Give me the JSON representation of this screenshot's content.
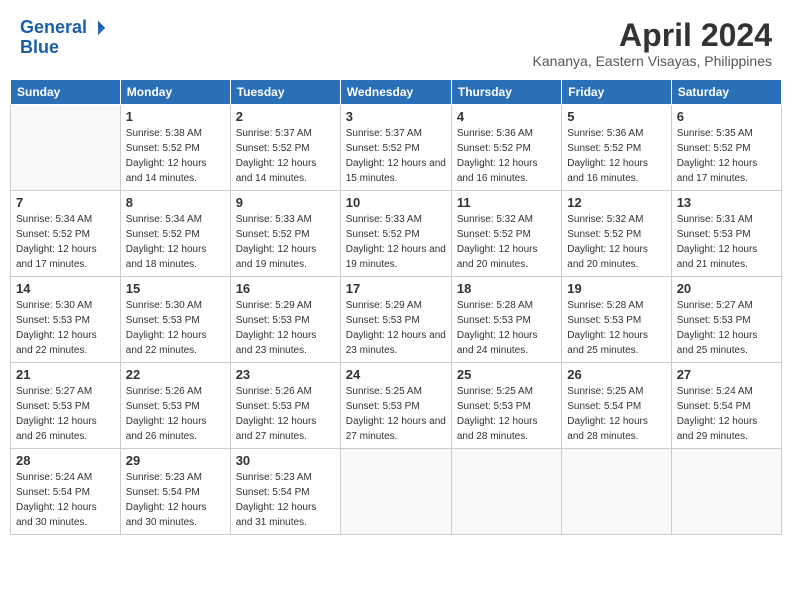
{
  "header": {
    "logo_line1": "General",
    "logo_line2": "Blue",
    "month": "April 2024",
    "location": "Kananya, Eastern Visayas, Philippines"
  },
  "weekdays": [
    "Sunday",
    "Monday",
    "Tuesday",
    "Wednesday",
    "Thursday",
    "Friday",
    "Saturday"
  ],
  "weeks": [
    [
      {
        "day": "",
        "sunrise": "",
        "sunset": "",
        "daylight": ""
      },
      {
        "day": "1",
        "sunrise": "Sunrise: 5:38 AM",
        "sunset": "Sunset: 5:52 PM",
        "daylight": "Daylight: 12 hours and 14 minutes."
      },
      {
        "day": "2",
        "sunrise": "Sunrise: 5:37 AM",
        "sunset": "Sunset: 5:52 PM",
        "daylight": "Daylight: 12 hours and 14 minutes."
      },
      {
        "day": "3",
        "sunrise": "Sunrise: 5:37 AM",
        "sunset": "Sunset: 5:52 PM",
        "daylight": "Daylight: 12 hours and 15 minutes."
      },
      {
        "day": "4",
        "sunrise": "Sunrise: 5:36 AM",
        "sunset": "Sunset: 5:52 PM",
        "daylight": "Daylight: 12 hours and 16 minutes."
      },
      {
        "day": "5",
        "sunrise": "Sunrise: 5:36 AM",
        "sunset": "Sunset: 5:52 PM",
        "daylight": "Daylight: 12 hours and 16 minutes."
      },
      {
        "day": "6",
        "sunrise": "Sunrise: 5:35 AM",
        "sunset": "Sunset: 5:52 PM",
        "daylight": "Daylight: 12 hours and 17 minutes."
      }
    ],
    [
      {
        "day": "7",
        "sunrise": "Sunrise: 5:34 AM",
        "sunset": "Sunset: 5:52 PM",
        "daylight": "Daylight: 12 hours and 17 minutes."
      },
      {
        "day": "8",
        "sunrise": "Sunrise: 5:34 AM",
        "sunset": "Sunset: 5:52 PM",
        "daylight": "Daylight: 12 hours and 18 minutes."
      },
      {
        "day": "9",
        "sunrise": "Sunrise: 5:33 AM",
        "sunset": "Sunset: 5:52 PM",
        "daylight": "Daylight: 12 hours and 19 minutes."
      },
      {
        "day": "10",
        "sunrise": "Sunrise: 5:33 AM",
        "sunset": "Sunset: 5:52 PM",
        "daylight": "Daylight: 12 hours and 19 minutes."
      },
      {
        "day": "11",
        "sunrise": "Sunrise: 5:32 AM",
        "sunset": "Sunset: 5:52 PM",
        "daylight": "Daylight: 12 hours and 20 minutes."
      },
      {
        "day": "12",
        "sunrise": "Sunrise: 5:32 AM",
        "sunset": "Sunset: 5:52 PM",
        "daylight": "Daylight: 12 hours and 20 minutes."
      },
      {
        "day": "13",
        "sunrise": "Sunrise: 5:31 AM",
        "sunset": "Sunset: 5:53 PM",
        "daylight": "Daylight: 12 hours and 21 minutes."
      }
    ],
    [
      {
        "day": "14",
        "sunrise": "Sunrise: 5:30 AM",
        "sunset": "Sunset: 5:53 PM",
        "daylight": "Daylight: 12 hours and 22 minutes."
      },
      {
        "day": "15",
        "sunrise": "Sunrise: 5:30 AM",
        "sunset": "Sunset: 5:53 PM",
        "daylight": "Daylight: 12 hours and 22 minutes."
      },
      {
        "day": "16",
        "sunrise": "Sunrise: 5:29 AM",
        "sunset": "Sunset: 5:53 PM",
        "daylight": "Daylight: 12 hours and 23 minutes."
      },
      {
        "day": "17",
        "sunrise": "Sunrise: 5:29 AM",
        "sunset": "Sunset: 5:53 PM",
        "daylight": "Daylight: 12 hours and 23 minutes."
      },
      {
        "day": "18",
        "sunrise": "Sunrise: 5:28 AM",
        "sunset": "Sunset: 5:53 PM",
        "daylight": "Daylight: 12 hours and 24 minutes."
      },
      {
        "day": "19",
        "sunrise": "Sunrise: 5:28 AM",
        "sunset": "Sunset: 5:53 PM",
        "daylight": "Daylight: 12 hours and 25 minutes."
      },
      {
        "day": "20",
        "sunrise": "Sunrise: 5:27 AM",
        "sunset": "Sunset: 5:53 PM",
        "daylight": "Daylight: 12 hours and 25 minutes."
      }
    ],
    [
      {
        "day": "21",
        "sunrise": "Sunrise: 5:27 AM",
        "sunset": "Sunset: 5:53 PM",
        "daylight": "Daylight: 12 hours and 26 minutes."
      },
      {
        "day": "22",
        "sunrise": "Sunrise: 5:26 AM",
        "sunset": "Sunset: 5:53 PM",
        "daylight": "Daylight: 12 hours and 26 minutes."
      },
      {
        "day": "23",
        "sunrise": "Sunrise: 5:26 AM",
        "sunset": "Sunset: 5:53 PM",
        "daylight": "Daylight: 12 hours and 27 minutes."
      },
      {
        "day": "24",
        "sunrise": "Sunrise: 5:25 AM",
        "sunset": "Sunset: 5:53 PM",
        "daylight": "Daylight: 12 hours and 27 minutes."
      },
      {
        "day": "25",
        "sunrise": "Sunrise: 5:25 AM",
        "sunset": "Sunset: 5:53 PM",
        "daylight": "Daylight: 12 hours and 28 minutes."
      },
      {
        "day": "26",
        "sunrise": "Sunrise: 5:25 AM",
        "sunset": "Sunset: 5:54 PM",
        "daylight": "Daylight: 12 hours and 28 minutes."
      },
      {
        "day": "27",
        "sunrise": "Sunrise: 5:24 AM",
        "sunset": "Sunset: 5:54 PM",
        "daylight": "Daylight: 12 hours and 29 minutes."
      }
    ],
    [
      {
        "day": "28",
        "sunrise": "Sunrise: 5:24 AM",
        "sunset": "Sunset: 5:54 PM",
        "daylight": "Daylight: 12 hours and 30 minutes."
      },
      {
        "day": "29",
        "sunrise": "Sunrise: 5:23 AM",
        "sunset": "Sunset: 5:54 PM",
        "daylight": "Daylight: 12 hours and 30 minutes."
      },
      {
        "day": "30",
        "sunrise": "Sunrise: 5:23 AM",
        "sunset": "Sunset: 5:54 PM",
        "daylight": "Daylight: 12 hours and 31 minutes."
      },
      {
        "day": "",
        "sunrise": "",
        "sunset": "",
        "daylight": ""
      },
      {
        "day": "",
        "sunrise": "",
        "sunset": "",
        "daylight": ""
      },
      {
        "day": "",
        "sunrise": "",
        "sunset": "",
        "daylight": ""
      },
      {
        "day": "",
        "sunrise": "",
        "sunset": "",
        "daylight": ""
      }
    ]
  ]
}
